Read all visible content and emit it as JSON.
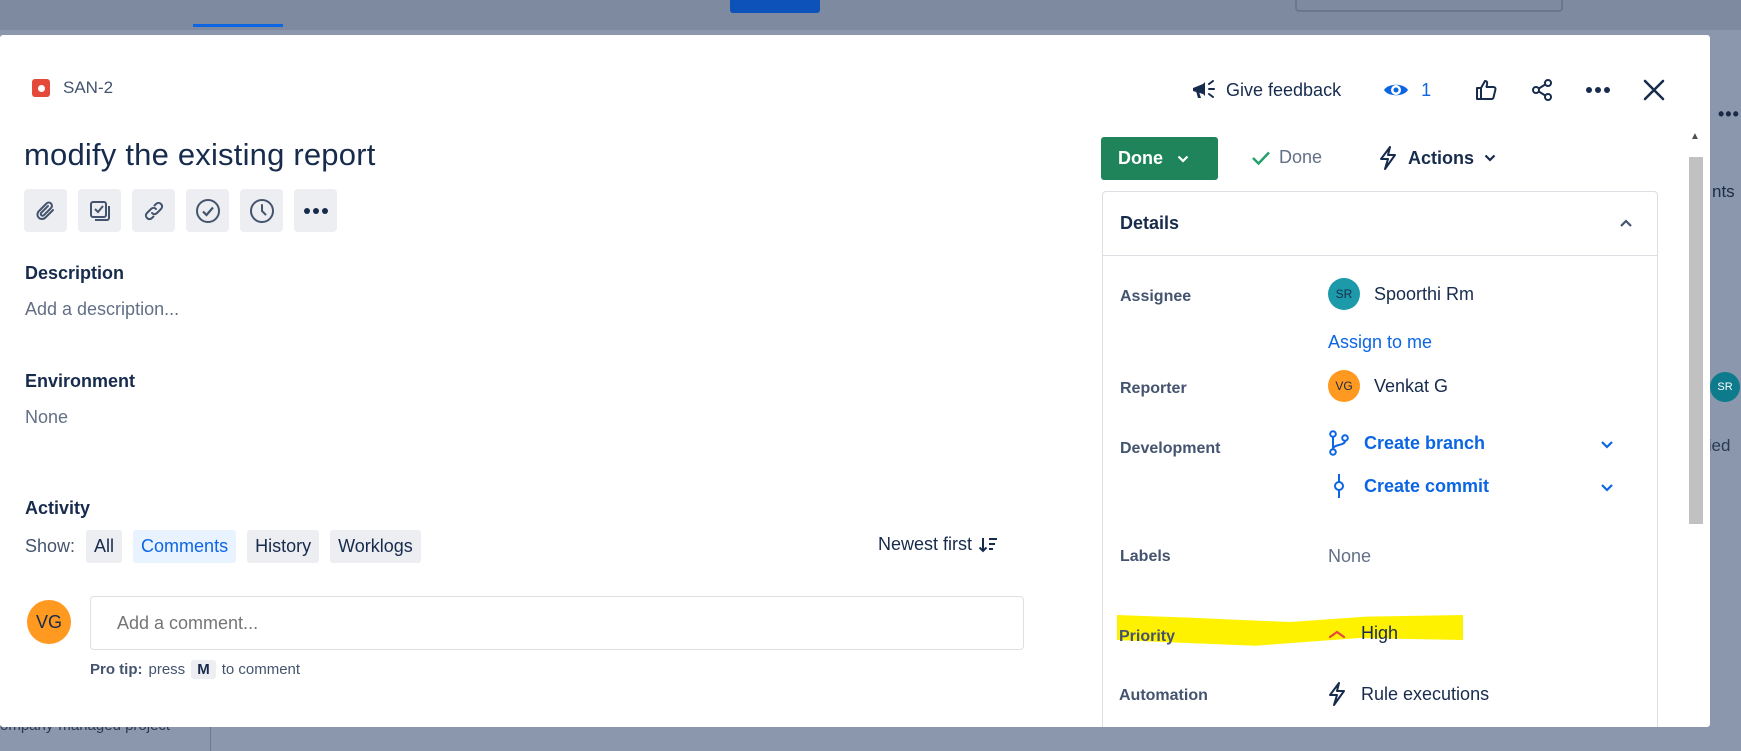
{
  "background": {
    "right_text_1": "nts",
    "right_text_2": "fied",
    "right_avatar": "SR",
    "bottom_text": "ompany-managed project"
  },
  "issue": {
    "key": "SAN-2",
    "summary": "modify the existing report",
    "type_icon": "bug-icon"
  },
  "top_actions": {
    "feedback_label": "Give feedback",
    "watch_count": "1"
  },
  "description": {
    "label": "Description",
    "placeholder": "Add a description..."
  },
  "environment": {
    "label": "Environment",
    "value": "None"
  },
  "activity": {
    "label": "Activity",
    "show_label": "Show:",
    "filters": [
      "All",
      "Comments",
      "History",
      "Worklogs"
    ],
    "active_filter": "Comments",
    "sort_label": "Newest first",
    "comment_avatar": "VG",
    "comment_placeholder": "Add a comment...",
    "protip_bold": "Pro tip:",
    "protip_press": "press",
    "protip_key": "M",
    "protip_suffix": "to comment"
  },
  "status": {
    "button_label": "Done",
    "resolution": "Done",
    "actions_label": "Actions"
  },
  "details": {
    "header": "Details",
    "assignee_label": "Assignee",
    "assignee_initials": "SR",
    "assignee_name": "Spoorthi Rm",
    "assign_to_me": "Assign to me",
    "reporter_label": "Reporter",
    "reporter_initials": "VG",
    "reporter_name": "Venkat G",
    "development_label": "Development",
    "create_branch": "Create branch",
    "create_commit": "Create commit",
    "labels_label": "Labels",
    "labels_value": "None",
    "priority_label": "Priority",
    "priority_value": "High",
    "automation_label": "Automation",
    "automation_value": "Rule executions"
  },
  "colors": {
    "status_green": "#1F845A",
    "link_blue": "#0C66E4",
    "highlight_yellow": "#FFF200",
    "assignee_avatar": "#1D9AAA",
    "reporter_avatar": "#FF991F",
    "priority_red": "#E5493A"
  }
}
